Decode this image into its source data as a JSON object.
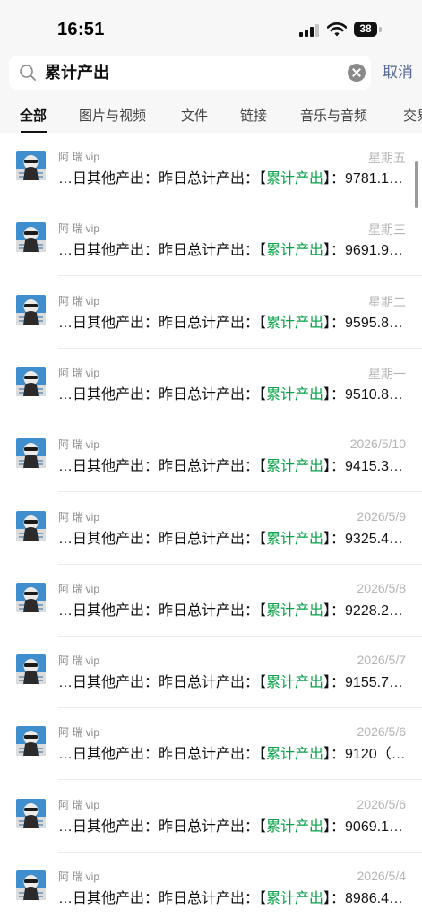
{
  "status_bar": {
    "time": "16:51",
    "battery": "38"
  },
  "search": {
    "query": "累计产出",
    "cancel_label": "取消"
  },
  "tabs": [
    {
      "label": "全部",
      "active": true
    },
    {
      "label": "图片与视频",
      "active": false
    },
    {
      "label": "文件",
      "active": false
    },
    {
      "label": "链接",
      "active": false
    },
    {
      "label": "音乐与音频",
      "active": false
    },
    {
      "label": "交易",
      "active": false
    }
  ],
  "results": [
    {
      "sender": "阿 瑞 vip",
      "date": "星期五",
      "prefix": "…日其他产出：昨日总计产出：【",
      "highlight": "累计产出",
      "suffix": "】：9781.1…"
    },
    {
      "sender": "阿 瑞 vip",
      "date": "星期三",
      "prefix": "…日其他产出：昨日总计产出：【",
      "highlight": "累计产出",
      "suffix": "】：9691.9…"
    },
    {
      "sender": "阿 瑞 vip",
      "date": "星期二",
      "prefix": "…日其他产出：昨日总计产出：【",
      "highlight": "累计产出",
      "suffix": "】：9595.8…"
    },
    {
      "sender": "阿 瑞 vip",
      "date": "星期一",
      "prefix": "…日其他产出：昨日总计产出：【",
      "highlight": "累计产出",
      "suffix": "】：9510.8…"
    },
    {
      "sender": "阿 瑞 vip",
      "date": "2026/5/10",
      "prefix": "…日其他产出：昨日总计产出：【",
      "highlight": "累计产出",
      "suffix": "】：9415.3…"
    },
    {
      "sender": "阿 瑞 vip",
      "date": "2026/5/9",
      "prefix": "…日其他产出：昨日总计产出：【",
      "highlight": "累计产出",
      "suffix": "】：9325.4…"
    },
    {
      "sender": "阿 瑞 vip",
      "date": "2026/5/8",
      "prefix": "…日其他产出：昨日总计产出：【",
      "highlight": "累计产出",
      "suffix": "】：9228.2…"
    },
    {
      "sender": "阿 瑞 vip",
      "date": "2026/5/7",
      "prefix": "…日其他产出：昨日总计产出：【",
      "highlight": "累计产出",
      "suffix": "】：9155.7…"
    },
    {
      "sender": "阿 瑞 vip",
      "date": "2026/5/6",
      "prefix": "…日其他产出：昨日总计产出：【",
      "highlight": "累计产出",
      "suffix": "】：9120（…"
    },
    {
      "sender": "阿 瑞 vip",
      "date": "2026/5/6",
      "prefix": "…日其他产出：昨日总计产出：【",
      "highlight": "累计产出",
      "suffix": "】：9069.1…"
    },
    {
      "sender": "阿 瑞 vip",
      "date": "2026/5/4",
      "prefix": "…日其他产出：昨日总计产出：【",
      "highlight": "累计产出",
      "suffix": "】：8986.4…"
    }
  ],
  "colors": {
    "highlight": "#07a346",
    "link": "#576b95",
    "date": "#b5b5b5"
  }
}
